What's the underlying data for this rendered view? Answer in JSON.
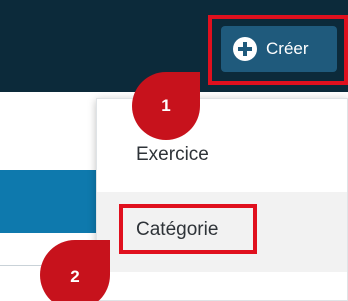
{
  "header": {
    "create_label": "Créer",
    "create_icon": "plus-circle-icon"
  },
  "menu": {
    "items": [
      {
        "label": "Exercice"
      },
      {
        "label": "Catégorie"
      }
    ]
  },
  "annotations": {
    "step1": "1",
    "step2": "2"
  },
  "colors": {
    "topbar": "#0c2a3a",
    "accent_bar": "#0e79ad",
    "button": "#1f5a7c",
    "highlight": "#e0101e",
    "badge": "#c7121c"
  }
}
